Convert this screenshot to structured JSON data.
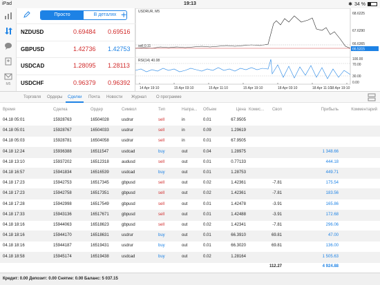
{
  "status": {
    "device": "iPad",
    "time": "19:13",
    "battery": "34 %",
    "battery_level": 0.34
  },
  "sidebar": {
    "items": [
      "chart-icon",
      "trade-icon",
      "chat-icon",
      "news-icon",
      "mail-icon"
    ],
    "bottom_label": "M5"
  },
  "quotes": {
    "mode_simple": "Просто",
    "mode_detailed": "В деталях",
    "rows": [
      {
        "symbol": "NZDUSD",
        "bid": "0.69484",
        "ask": "0.69516",
        "ask_color": "red"
      },
      {
        "symbol": "GBPUSD",
        "bid": "1.42736",
        "ask": "1.42753",
        "ask_color": "blue"
      },
      {
        "symbol": "USDCAD",
        "bid": "1.28095",
        "ask": "1.28113",
        "ask_color": "red"
      },
      {
        "symbol": "USDCHF",
        "bid": "0.96379",
        "ask": "0.96392",
        "ask_color": "red"
      }
    ]
  },
  "chart": {
    "title": "USDRUR, M5",
    "sell_label": "sell 0.11",
    "price_ticks": [
      "68.6225",
      "67.6290",
      "66.6365",
      "66.5315"
    ],
    "rsi_label": "RSI(14) 40.08",
    "rsi_ticks": [
      "100.00",
      "70.00",
      "30.00",
      "0.00"
    ],
    "time_ticks": [
      "14 Apr 19:10",
      "15 Apr 03:10",
      "15 Apr 11:10",
      "15 Apr 19:10",
      "18 Apr 03:10",
      "18 Apr 11:10",
      "18 Apr 19:10"
    ]
  },
  "tabs": {
    "items": [
      {
        "label": "Торговля",
        "active": false
      },
      {
        "label": "Ордеры",
        "active": false
      },
      {
        "label": "Сделки",
        "active": true
      },
      {
        "label": "Почта",
        "active": false
      },
      {
        "label": "Новости",
        "active": false
      },
      {
        "label": "Журнал",
        "active": false
      },
      {
        "label": "О программе",
        "active": false
      }
    ]
  },
  "table": {
    "headers": {
      "time": "Время",
      "deal": "Сделка",
      "order": "Ордер",
      "symbol": "Символ",
      "type": "Тип",
      "direction": "Напра...",
      "volume": "Объем",
      "price": "Цена",
      "commission": "Комис...",
      "swap": "Своп",
      "profit": "Прибыль",
      "comment": "Комментарий"
    },
    "rows": [
      {
        "time": "04.18 05:01",
        "deal": "15928763",
        "order": "16504028",
        "symbol": "usdrur",
        "type": "sell",
        "direction": "in",
        "volume": "0.01",
        "price": "67.9505",
        "swap": "",
        "profit": ""
      },
      {
        "time": "04.18 05:01",
        "deal": "15928767",
        "order": "16504033",
        "symbol": "usdrur",
        "type": "sell",
        "direction": "in",
        "volume": "0.09",
        "price": "1.29619",
        "swap": "",
        "profit": ""
      },
      {
        "time": "04.18 05:03",
        "deal": "15928781",
        "order": "16504058",
        "symbol": "usdrur",
        "type": "sell",
        "direction": "in",
        "volume": "0.01",
        "price": "67.9505",
        "swap": "",
        "profit": ""
      },
      {
        "time": "04.18 12:24",
        "deal": "15936388",
        "order": "16511547",
        "symbol": "usdcad",
        "type": "buy",
        "direction": "out",
        "volume": "0.04",
        "price": "1.28975",
        "swap": "",
        "profit": "1 348.66"
      },
      {
        "time": "04.18 13:10",
        "deal": "15937202",
        "order": "16512318",
        "symbol": "audusd",
        "type": "sell",
        "direction": "out",
        "volume": "0.01",
        "price": "0.77133",
        "swap": "",
        "profit": "444.18"
      },
      {
        "time": "04.18 16:57",
        "deal": "15941834",
        "order": "16516539",
        "symbol": "usdcad",
        "type": "buy",
        "direction": "out",
        "volume": "0.01",
        "price": "1.28753",
        "swap": "",
        "profit": "449.71"
      },
      {
        "time": "04.18 17:23",
        "deal": "15942753",
        "order": "16517345",
        "symbol": "gbpusd",
        "type": "sell",
        "direction": "out",
        "volume": "0.02",
        "price": "1.42361",
        "swap": "-7.81",
        "profit": "175.54"
      },
      {
        "time": "04.18 17:23",
        "deal": "15942758",
        "order": "16517351",
        "symbol": "gbpusd",
        "type": "sell",
        "direction": "out",
        "volume": "0.02",
        "price": "1.42361",
        "swap": "-7.81",
        "profit": "183.56"
      },
      {
        "time": "04.18 17:28",
        "deal": "15942998",
        "order": "16517549",
        "symbol": "gbpusd",
        "type": "sell",
        "direction": "out",
        "volume": "0.01",
        "price": "1.42478",
        "swap": "-3.91",
        "profit": "165.86"
      },
      {
        "time": "04.18 17:33",
        "deal": "15943136",
        "order": "16517671",
        "symbol": "gbpusd",
        "type": "sell",
        "direction": "out",
        "volume": "0.01",
        "price": "1.42488",
        "swap": "-3.91",
        "profit": "172.68"
      },
      {
        "time": "04.18 18:16",
        "deal": "15944063",
        "order": "16518623",
        "symbol": "gbpusd",
        "type": "sell",
        "direction": "out",
        "volume": "0.02",
        "price": "1.42341",
        "swap": "-7.81",
        "profit": "296.06"
      },
      {
        "time": "04.18 18:16",
        "deal": "15944170",
        "order": "16518631",
        "symbol": "usdrur",
        "type": "buy",
        "direction": "out",
        "volume": "0.01",
        "price": "66.3910",
        "swap": "69.81",
        "profit": "47.00"
      },
      {
        "time": "04.18 18:16",
        "deal": "15944187",
        "order": "16519431",
        "symbol": "usdrur",
        "type": "buy",
        "direction": "out",
        "volume": "0.01",
        "price": "66.3020",
        "swap": "69.81",
        "profit": "136.00"
      },
      {
        "time": "04.18 18:58",
        "deal": "15945174",
        "order": "16519438",
        "symbol": "usdcad",
        "type": "buy",
        "direction": "out",
        "volume": "0.02",
        "price": "1.28164",
        "swap": "",
        "profit": "1 505.63"
      }
    ],
    "summary": {
      "swap": "112.27",
      "profit": "4 924.88"
    }
  },
  "footer": {
    "text": "Кредит: 0.00 Депозит: 0.00 Снятие: 0.00 Баланс: 5 037.15"
  },
  "colors": {
    "accent": "#1d82e5",
    "sell": "#d12b2b"
  }
}
